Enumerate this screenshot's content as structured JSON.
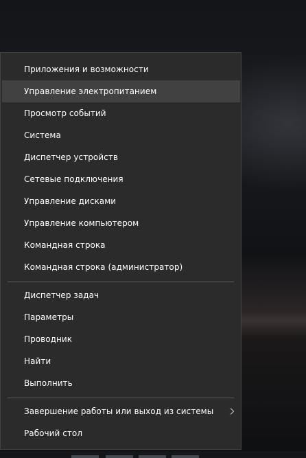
{
  "context_menu": {
    "group1": [
      {
        "label": "Приложения и возможности"
      },
      {
        "label": "Управление электропитанием"
      },
      {
        "label": "Просмотр событий"
      },
      {
        "label": "Система"
      },
      {
        "label": "Диспетчер устройств"
      },
      {
        "label": "Сетевые подключения"
      },
      {
        "label": "Управление дисками"
      },
      {
        "label": "Управление компьютером"
      },
      {
        "label": "Командная строка"
      },
      {
        "label": "Командная строка (администратор)"
      }
    ],
    "group2": [
      {
        "label": "Диспетчер задач"
      },
      {
        "label": "Параметры"
      },
      {
        "label": "Проводник"
      },
      {
        "label": "Найти"
      },
      {
        "label": "Выполнить"
      }
    ],
    "group3": [
      {
        "label": "Завершение работы или выход из системы",
        "submenu_icon": "chevron-right-icon"
      },
      {
        "label": "Рабочий стол"
      }
    ],
    "highlighted_item": "Управление электропитанием"
  },
  "colors": {
    "menu_background": "#2b2b2b",
    "menu_border": "#444444",
    "hover_background": "#414141",
    "separator": "#5a5a5a",
    "text": "#ffffff"
  }
}
